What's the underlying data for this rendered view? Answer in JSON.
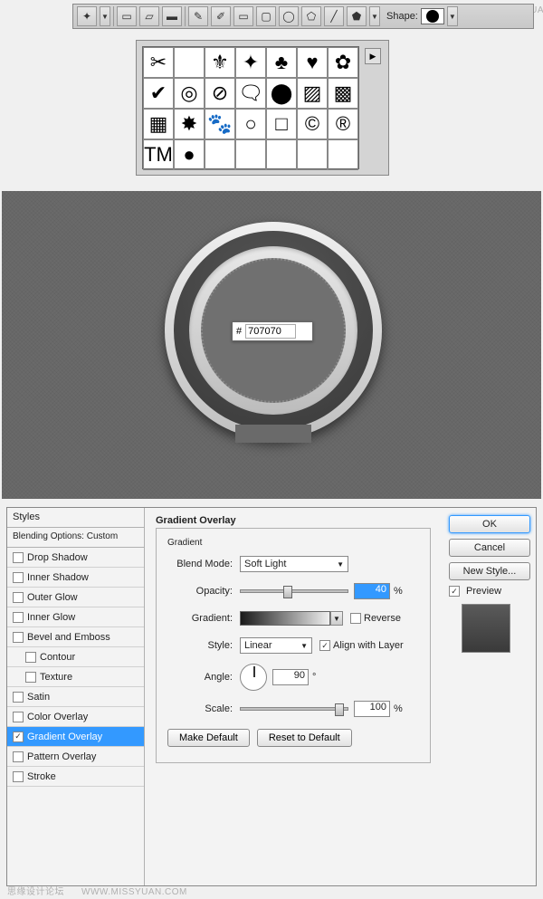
{
  "watermark": {
    "left": "思缘设计论坛",
    "right": "WWW.MISSYUAN.COM"
  },
  "toolbar": {
    "shape_label": "Shape:",
    "tools": [
      "blob",
      "sep",
      "rect",
      "rrec",
      "elli",
      "sep",
      "pen",
      "free",
      "add",
      "del",
      "conv",
      "sep",
      "path",
      "sep",
      "cust"
    ]
  },
  "shapes_grid": {
    "cols": 7,
    "rows": 4,
    "cells": [
      "✂",
      "",
      "⚜",
      "✦",
      "♣",
      "♥",
      "✿",
      "✔",
      "◎",
      "⊘",
      "🗨",
      "⬤",
      "▨",
      "▩",
      "▦",
      "✸",
      "🐾",
      "○",
      "□",
      "©",
      "®",
      "TM",
      "●",
      "",
      "",
      "",
      "",
      ""
    ]
  },
  "knob": {
    "hex_label": "#",
    "hex_value": "707070"
  },
  "dialog": {
    "styles_header": "Styles",
    "blending_header": "Blending Options: Custom",
    "items": [
      {
        "label": "Drop Shadow",
        "checked": false
      },
      {
        "label": "Inner Shadow",
        "checked": false
      },
      {
        "label": "Outer Glow",
        "checked": false
      },
      {
        "label": "Inner Glow",
        "checked": false
      },
      {
        "label": "Bevel and Emboss",
        "checked": false
      },
      {
        "label": "Contour",
        "checked": false,
        "indent": true
      },
      {
        "label": "Texture",
        "checked": false,
        "indent": true
      },
      {
        "label": "Satin",
        "checked": false
      },
      {
        "label": "Color Overlay",
        "checked": false
      },
      {
        "label": "Gradient Overlay",
        "checked": true,
        "active": true
      },
      {
        "label": "Pattern Overlay",
        "checked": false
      },
      {
        "label": "Stroke",
        "checked": false
      }
    ],
    "section_title": "Gradient Overlay",
    "sub_title": "Gradient",
    "blend_mode_label": "Blend Mode:",
    "blend_mode_value": "Soft Light",
    "opacity_label": "Opacity:",
    "opacity_value": "40",
    "opacity_unit": "%",
    "gradient_label": "Gradient:",
    "reverse_label": "Reverse",
    "reverse_checked": false,
    "style_label": "Style:",
    "style_value": "Linear",
    "align_label": "Align with Layer",
    "align_checked": true,
    "angle_label": "Angle:",
    "angle_value": "90",
    "angle_unit": "°",
    "scale_label": "Scale:",
    "scale_value": "100",
    "scale_unit": "%",
    "make_default": "Make Default",
    "reset_default": "Reset to Default",
    "ok": "OK",
    "cancel": "Cancel",
    "new_style": "New Style...",
    "preview_label": "Preview",
    "preview_checked": true
  }
}
